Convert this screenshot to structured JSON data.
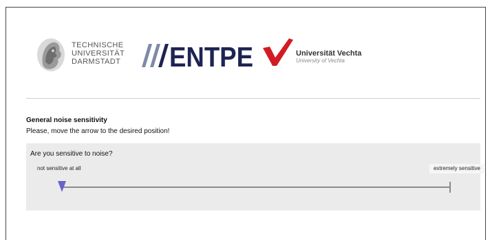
{
  "logos": {
    "tud": {
      "icon": "athena-seal-icon",
      "lines": [
        "TECHNISCHE",
        "UNIVERSITÄT",
        "DARMSTADT"
      ]
    },
    "entpe": {
      "text": "ENTPE",
      "color": "#1d2452",
      "stripe_color": "#7f8aa8"
    },
    "vechta": {
      "icon": "checkmark-mark-icon",
      "name": "Universität Vechta",
      "subtitle": "University of Vechta",
      "color": "#d11c24"
    }
  },
  "question": {
    "title": "General noise sensitivity",
    "instruction": "Please, move the arrow to the desired position!",
    "prompt": "Are you sensitive to noise?",
    "min_label": "not sensitive at all",
    "max_label": "extremely sensitive",
    "value": 0.0,
    "handle_color": "#6a63c9"
  }
}
